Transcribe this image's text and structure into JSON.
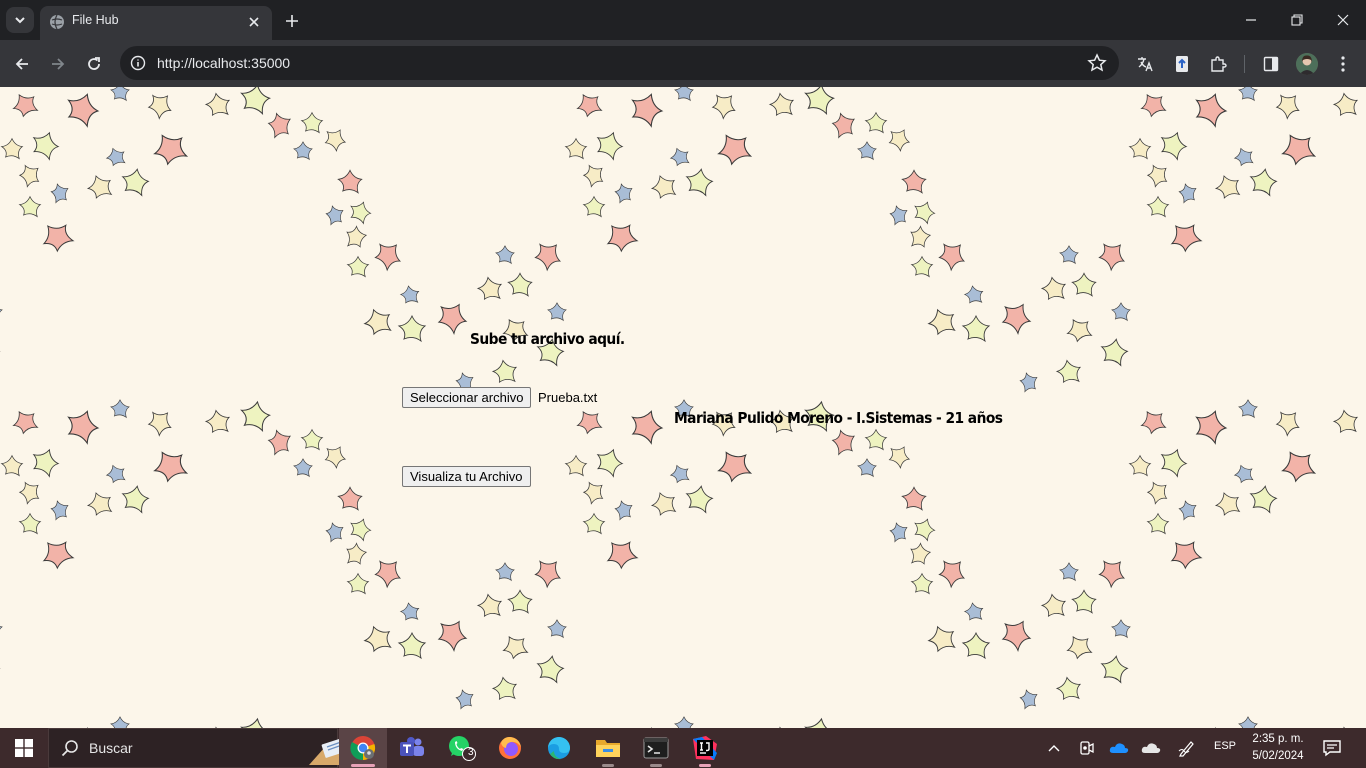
{
  "browser": {
    "tab_title": "File Hub",
    "url": "http://localhost:35000"
  },
  "page": {
    "upload_title": "Sube tu archivo aquí.",
    "file_button_label": "Seleccionar archivo",
    "file_name": "Prueba.txt",
    "author_line": "Mariana Pulido Moreno - I.Sistemas - 21 años",
    "view_button_label": "Visualiza tu Archivo",
    "background_color": "#fcf6ea",
    "leaf_colors": [
      "#f2b3a8",
      "#eef3c0",
      "#f7ecc6",
      "#a9bdd6"
    ]
  },
  "taskbar": {
    "search_placeholder": "Buscar",
    "whatsapp_badge": "3",
    "language": "ESP",
    "time": "2:35 p. m.",
    "date": "5/02/2024",
    "apps": [
      "chrome",
      "teams",
      "whatsapp",
      "firefox",
      "edge",
      "file-explorer",
      "terminal",
      "intellij"
    ]
  }
}
